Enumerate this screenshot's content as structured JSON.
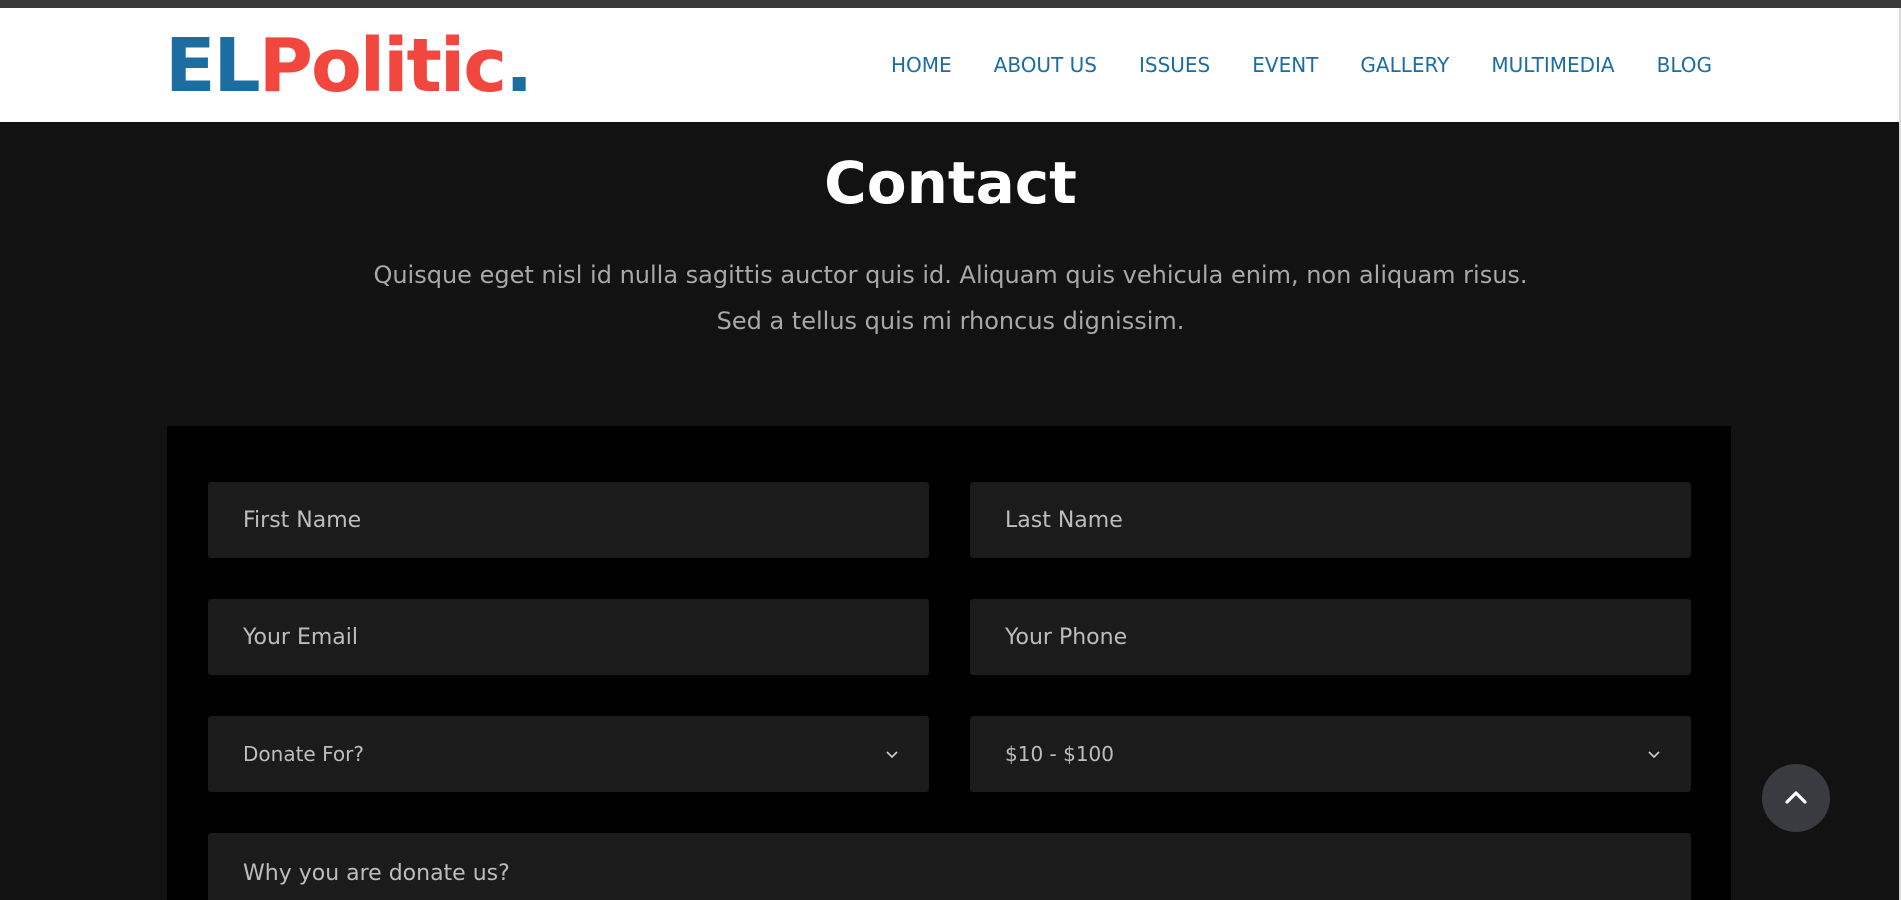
{
  "brand": {
    "logo_part_a": "EL",
    "logo_part_b": "Politic",
    "logo_part_c": "."
  },
  "nav": {
    "items": [
      "HOME",
      "ABOUT US",
      "ISSUES",
      "EVENT",
      "GALLERY",
      "MULTIMEDIA",
      "BLOG"
    ]
  },
  "contact": {
    "title": "Contact",
    "intro_line1": "Quisque eget nisl id nulla sagittis auctor quis id. Aliquam quis vehicula enim, non aliquam risus.",
    "intro_line2": "Sed a tellus quis mi rhoncus dignissim."
  },
  "form": {
    "first_name_placeholder": "First Name",
    "last_name_placeholder": "Last Name",
    "email_placeholder": "Your Email",
    "phone_placeholder": "Your Phone",
    "donate_for_value": "Donate For?",
    "amount_value": "$10 - $100",
    "message_placeholder": "Why you are donate us?"
  },
  "icons": {
    "select_arrow": "chevron-down-icon",
    "back_to_top": "chevron-up-icon"
  },
  "colors": {
    "brand_blue": "#1b6da2",
    "brand_red": "#f2473f",
    "page_bg": "#121212",
    "form_bg": "#000000",
    "field_bg": "#1b1b1b"
  }
}
